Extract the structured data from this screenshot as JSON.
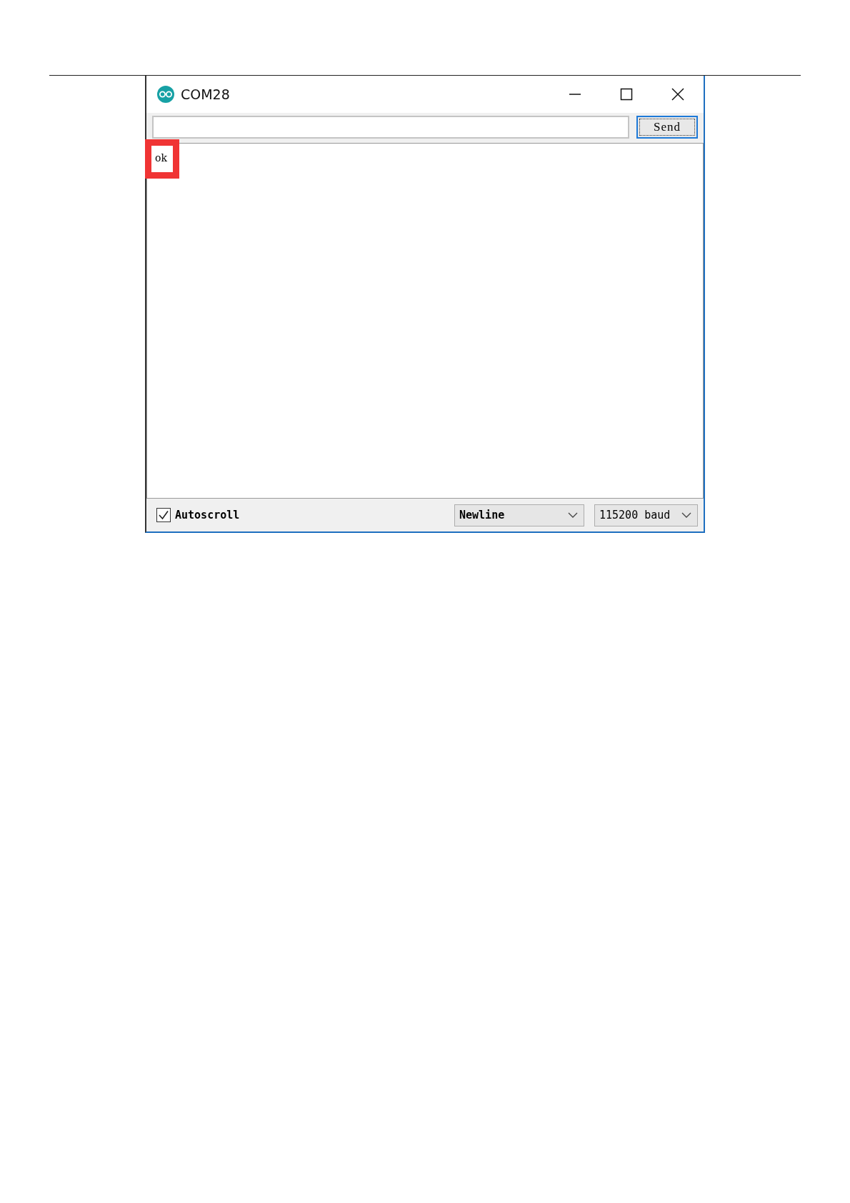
{
  "window": {
    "title": "COM28"
  },
  "send_button": {
    "label": "Send"
  },
  "output": {
    "lines": [
      {
        "text": "ok",
        "highlighted": true
      }
    ]
  },
  "autoscroll": {
    "label": "Autoscroll",
    "checked": true
  },
  "line_ending": {
    "value": "Newline"
  },
  "baud_rate": {
    "value": "115200 baud"
  }
}
